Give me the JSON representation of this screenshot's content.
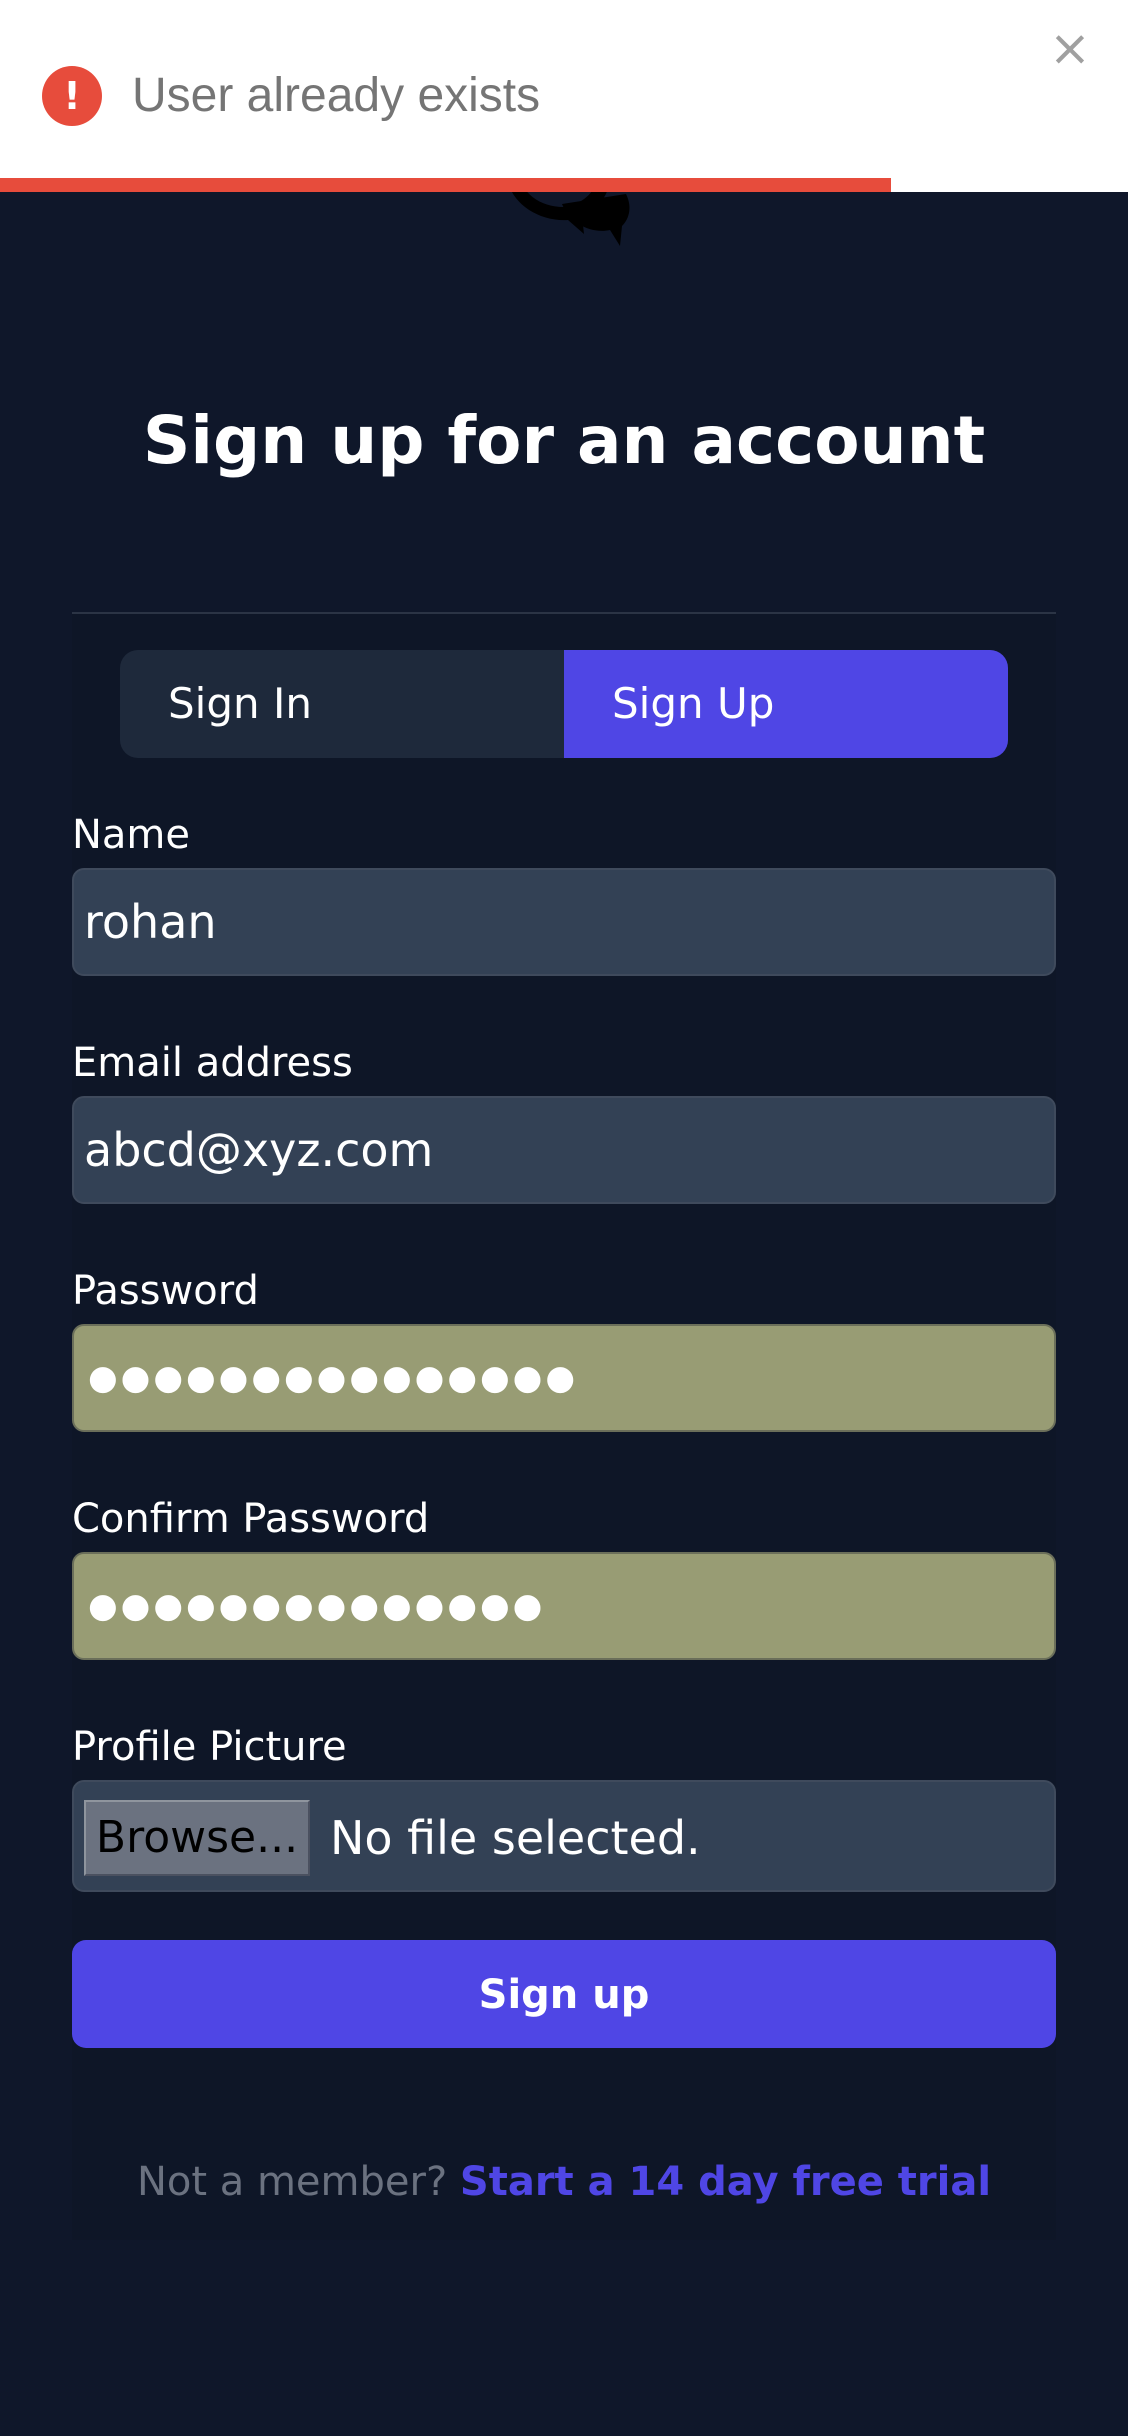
{
  "toast": {
    "message": "User already exists",
    "icon": "exclamation-icon",
    "icon_glyph": "!",
    "close_glyph": "×",
    "progress_percent": 79,
    "colors": {
      "background": "#ffffff",
      "accent": "#e74c3c",
      "text": "#757575"
    }
  },
  "logo": {
    "icon": "chat-bubbles-icon"
  },
  "heading": {
    "title": "Sign up for an account"
  },
  "tabs": [
    {
      "label": "Sign In",
      "active": false
    },
    {
      "label": "Sign Up",
      "active": true
    }
  ],
  "form": {
    "name": {
      "label": "Name",
      "value": "rohan"
    },
    "email": {
      "label": "Email address",
      "value": "abcd@xyz.com"
    },
    "password": {
      "label": "Password",
      "masked_value": "●●●●●●●●●●●●●●●"
    },
    "confirm_password": {
      "label": "Confirm Password",
      "masked_value": "●●●●●●●●●●●●●●"
    },
    "profile_picture": {
      "label": "Profile Picture",
      "button_label": "Browse...",
      "status": "No file selected."
    },
    "submit_label": "Sign up"
  },
  "footer": {
    "prompt": "Not a member?",
    "link_label": "Start a 14 day free trial"
  },
  "colors": {
    "page_background": "#0f172a",
    "input_background": "#334155",
    "autofill_background": "#989c74",
    "primary": "#4f46e5",
    "muted_text": "#6b7280"
  }
}
